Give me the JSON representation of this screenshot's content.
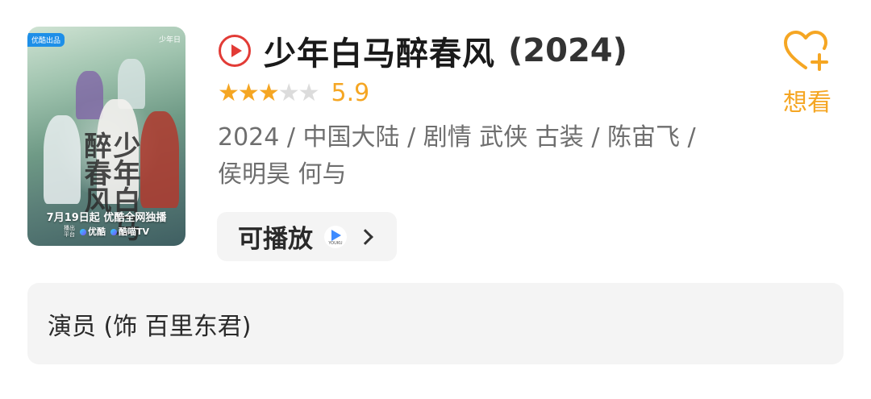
{
  "poster": {
    "badge_left": "优酷出品",
    "badge_right": "少年日",
    "calligraphy": "少年白马醉春风",
    "release_line": "7月19日起 优酷全网独播",
    "platform_small": "播出平台",
    "platform_1": "优酷",
    "platform_2": "酷喵TV"
  },
  "movie": {
    "title": "少年白马醉春风",
    "year": "(2024)",
    "rating": {
      "stars_filled": 3,
      "stars_total": 5,
      "value": "5.9"
    },
    "meta": "2024 / 中国大陆 / 剧情 武侠 古装 / 陈宙飞 / 侯明昊 何与"
  },
  "actions": {
    "playable_label": "可播放",
    "platform_icon_text": "YOUKU",
    "want_label": "想看"
  },
  "actor_card": {
    "text": "演员 (饰 百里东君)"
  },
  "colors": {
    "accent": "#f5a623",
    "play_red": "#e23b36",
    "meta_gray": "#6e6e6e",
    "card_bg": "#f4f4f4"
  }
}
